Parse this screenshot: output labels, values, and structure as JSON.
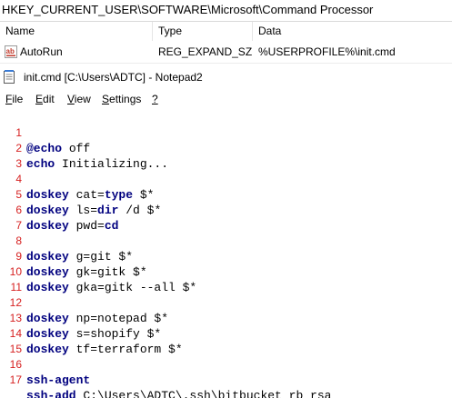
{
  "registry": {
    "path": "HKEY_CURRENT_USER\\SOFTWARE\\Microsoft\\Command Processor",
    "columns": {
      "name": "Name",
      "type": "Type",
      "data": "Data"
    },
    "row": {
      "name": "AutoRun",
      "type": "REG_EXPAND_SZ",
      "data": "%USERPROFILE%\\init.cmd",
      "icon": "reg-string-icon"
    }
  },
  "notepad": {
    "title": "init.cmd [C:\\Users\\ADTC] - Notepad2",
    "icon": "notepad-icon",
    "menu": {
      "file": {
        "acc": "F",
        "rest": "ile"
      },
      "edit": {
        "acc": "E",
        "rest": "dit"
      },
      "view": {
        "acc": "V",
        "rest": "iew"
      },
      "settings": {
        "acc": "S",
        "rest": "ettings"
      },
      "help": {
        "acc": "?",
        "rest": ""
      }
    },
    "lines": {
      "l1": {
        "no": "1",
        "kw": "@echo",
        "rest": " off"
      },
      "l2": {
        "no": "2",
        "kw": "echo",
        "rest": " Initializing..."
      },
      "l3": {
        "no": "3",
        "kw": "",
        "rest": ""
      },
      "l4": {
        "no": "4",
        "kw": "doskey",
        "a": " cat=",
        "kw2": "type",
        "b": " $*"
      },
      "l5": {
        "no": "5",
        "kw": "doskey",
        "a": " ls=",
        "kw2": "dir",
        "b": " /d $*"
      },
      "l6": {
        "no": "6",
        "kw": "doskey",
        "a": " pwd=",
        "kw2": "cd",
        "b": ""
      },
      "l7": {
        "no": "7",
        "kw": "",
        "rest": ""
      },
      "l8": {
        "no": "8",
        "kw": "doskey",
        "rest": " g=git $*"
      },
      "l9": {
        "no": "9",
        "kw": "doskey",
        "rest": " gk=gitk $*"
      },
      "l10": {
        "no": "10",
        "kw": "doskey",
        "rest": " gka=gitk --all $*"
      },
      "l11": {
        "no": "11",
        "kw": "",
        "rest": ""
      },
      "l12": {
        "no": "12",
        "kw": "doskey",
        "rest": " np=notepad $*"
      },
      "l13": {
        "no": "13",
        "kw": "doskey",
        "rest": " s=shopify $*"
      },
      "l14": {
        "no": "14",
        "kw": "doskey",
        "rest": " tf=terraform $*"
      },
      "l15": {
        "no": "15",
        "kw": "",
        "rest": ""
      },
      "l16": {
        "no": "16",
        "kw": "ssh-agent",
        "rest": ""
      },
      "l17": {
        "no": "17",
        "kw": "ssh-add",
        "rest": " C:\\Users\\ADTC\\.ssh\\bitbucket_rb_rsa"
      }
    }
  },
  "colors": {
    "line_number": "#d62020",
    "keyword": "#00007f",
    "text": "#000000",
    "background": "#ffffff"
  }
}
